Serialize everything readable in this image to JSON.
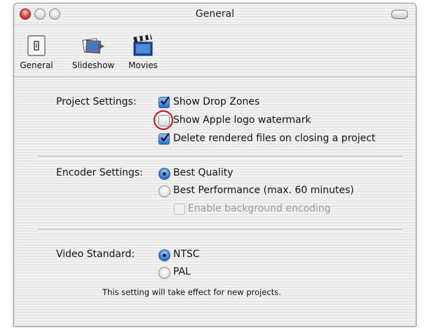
{
  "window": {
    "title": "General"
  },
  "toolbar": {
    "items": [
      {
        "label": "General",
        "icon": "general-prefs-icon"
      },
      {
        "label": "Slideshow",
        "icon": "slideshow-icon"
      },
      {
        "label": "Movies",
        "icon": "movies-clapper-icon"
      }
    ]
  },
  "project_settings": {
    "label": "Project Settings:",
    "options": [
      {
        "label": "Show Drop Zones",
        "checked": true
      },
      {
        "label": "Show Apple logo watermark",
        "checked": false
      },
      {
        "label": "Delete rendered files on closing a project",
        "checked": true
      }
    ]
  },
  "encoder_settings": {
    "label": "Encoder Settings:",
    "options": [
      {
        "label": "Best Quality",
        "selected": true
      },
      {
        "label": "Best Performance (max. 60 minutes)",
        "selected": false
      }
    ],
    "background_encoding": {
      "label": "Enable background encoding",
      "checked": false,
      "enabled": false
    }
  },
  "video_standard": {
    "label": "Video Standard:",
    "options": [
      {
        "label": "NTSC",
        "selected": true
      },
      {
        "label": "PAL",
        "selected": false
      }
    ],
    "note": "This setting will take effect for new projects."
  },
  "colors": {
    "accent": "#2a6fd1",
    "highlight_circle": "#b4161b"
  }
}
